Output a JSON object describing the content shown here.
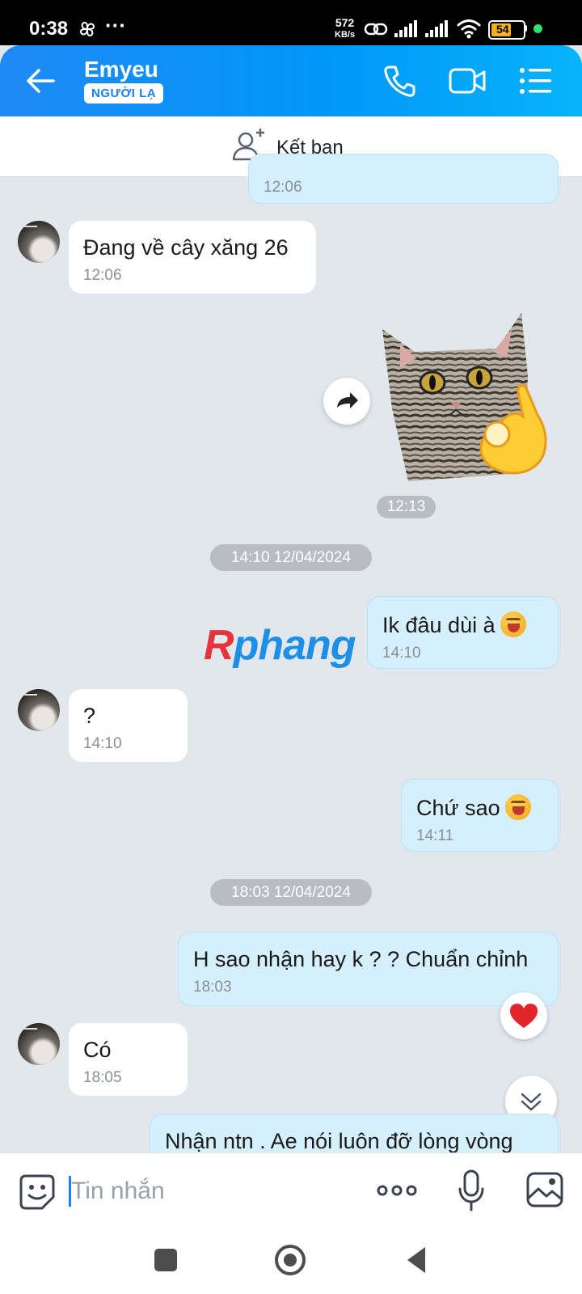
{
  "status_bar": {
    "time": "0:38",
    "dots": "···",
    "network_speed_value": "572",
    "network_speed_unit": "KB/s",
    "battery": "54"
  },
  "header": {
    "title": "Emyeu",
    "badge": "NGƯỜI LẠ"
  },
  "friend_bar": {
    "label": "Kết bạn"
  },
  "messages": [
    {
      "side": "out",
      "time": "12:06"
    },
    {
      "side": "in",
      "text": "Đang về cây xăng 26",
      "time": "12:06"
    },
    {
      "side": "out",
      "type": "sticker",
      "time": "12:13"
    },
    {
      "type": "date_separator",
      "text": "14:10 12/04/2024"
    },
    {
      "side": "out",
      "text": "Ik đâu dùi à",
      "time": "14:10"
    },
    {
      "side": "in",
      "text": "?",
      "time": "14:10"
    },
    {
      "side": "out",
      "text": "Chứ sao",
      "time": "14:11"
    },
    {
      "type": "date_separator",
      "text": "18:03 12/04/2024"
    },
    {
      "side": "out",
      "text": "H sao nhận hay k ? ? Chuẩn chỉnh",
      "time": "18:03"
    },
    {
      "side": "in",
      "text": "Có",
      "time": "18:05"
    },
    {
      "side": "out",
      "text": "Nhận ntn . Ae nói luôn đỡ lòng vòng"
    }
  ],
  "watermark": {
    "first": "R",
    "rest": "phang"
  },
  "input": {
    "placeholder": "Tin nhắn"
  },
  "colors": {
    "header_blue": "#1f8af5",
    "outgoing_bubble": "#d5effd",
    "incoming_bubble": "#ffffff",
    "chat_background": "#e2e6ed"
  }
}
